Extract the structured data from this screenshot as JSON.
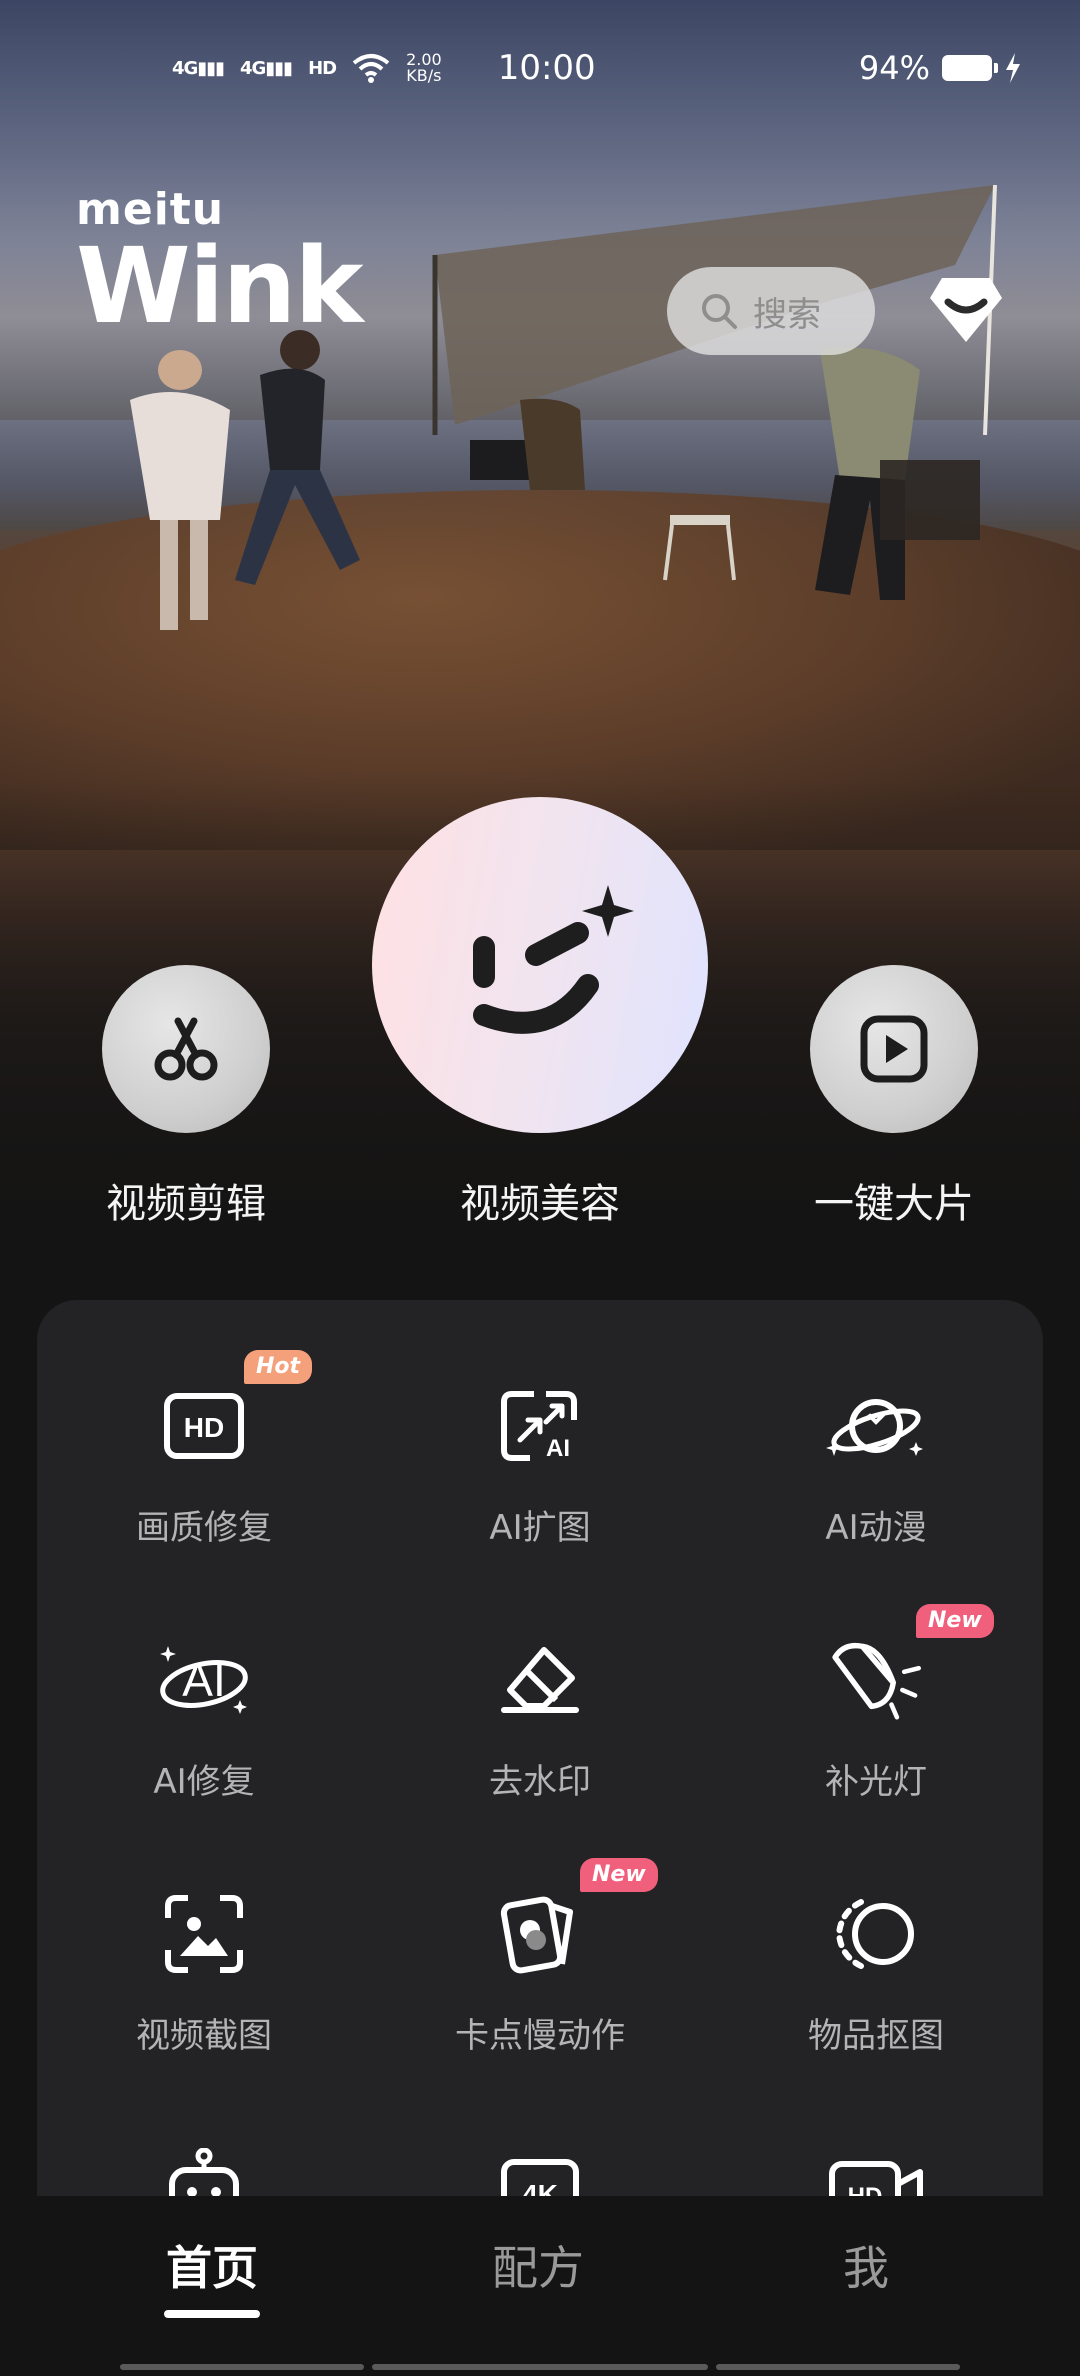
{
  "status_bar": {
    "signal_1": "4G",
    "signal_2": "4G",
    "hd": "HD",
    "net_speed_value": "2.00",
    "net_speed_unit": "KB/s",
    "time": "10:00",
    "battery_percent": "94%",
    "icons": [
      "signal-icon",
      "wifi-icon",
      "battery-icon",
      "charging-icon"
    ]
  },
  "brand": {
    "maker": "meitu",
    "app_name": "Wink"
  },
  "search": {
    "placeholder": "搜索",
    "icon": "search-icon"
  },
  "vip": {
    "icon": "diamond-icon"
  },
  "main_actions": [
    {
      "label": "视频剪辑",
      "icon": "scissors-icon"
    },
    {
      "label": "视频美容",
      "icon": "wink-face-icon"
    },
    {
      "label": "一键大片",
      "icon": "play-icon"
    }
  ],
  "tools": [
    {
      "label": "画质修复",
      "icon": "hd-icon",
      "badge": "Hot"
    },
    {
      "label": "AI扩图",
      "icon": "ai-expand-icon",
      "badge": ""
    },
    {
      "label": "AI动漫",
      "icon": "planet-icon",
      "badge": ""
    },
    {
      "label": "AI修复",
      "icon": "ai-repair-icon",
      "badge": ""
    },
    {
      "label": "去水印",
      "icon": "eraser-icon",
      "badge": ""
    },
    {
      "label": "补光灯",
      "icon": "spotlight-icon",
      "badge": "New"
    },
    {
      "label": "视频截图",
      "icon": "screenshot-icon",
      "badge": ""
    },
    {
      "label": "卡点慢动作",
      "icon": "card-motion-icon",
      "badge": "New"
    },
    {
      "label": "物品抠图",
      "icon": "cutout-icon",
      "badge": ""
    }
  ],
  "partial_tools": [
    {
      "icon": "robot-icon"
    },
    {
      "icon": "4k-icon"
    },
    {
      "icon": "hd-video-icon"
    }
  ],
  "bottom_nav": [
    {
      "label": "首页",
      "active": true
    },
    {
      "label": "配方",
      "active": false
    },
    {
      "label": "我",
      "active": false
    }
  ],
  "colors": {
    "background": "#141414",
    "panel": "#232325",
    "badge_hot": "#f4a07a",
    "badge_new": "#f0607c",
    "label_muted": "#b4b4b6"
  }
}
